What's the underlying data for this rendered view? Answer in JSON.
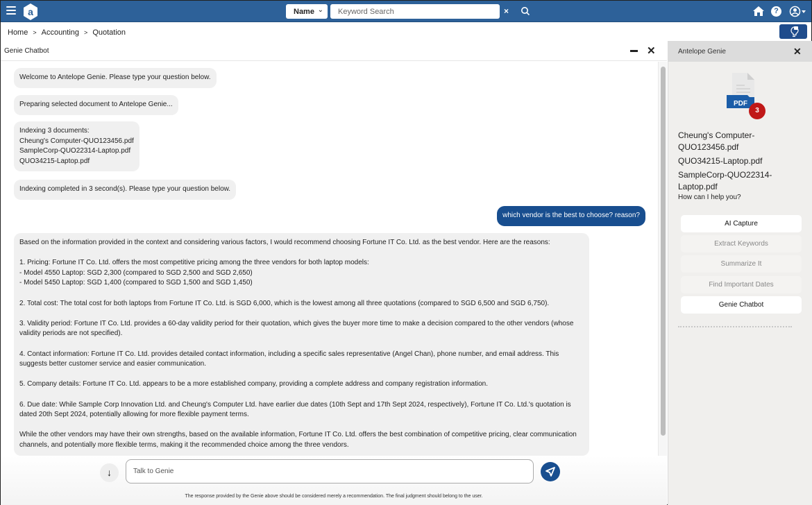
{
  "topbar": {
    "logo_letter": "a",
    "search_type": "Name",
    "search_placeholder": "Keyword Search",
    "search_value": "",
    "clear_label": "×",
    "help_label": "?"
  },
  "breadcrumb": [
    "Home",
    "Accounting",
    "Quotation"
  ],
  "chat": {
    "title": "Genie Chatbot",
    "messages": [
      {
        "role": "bot",
        "text": "Welcome to Antelope Genie. Please type your question below."
      },
      {
        "role": "bot",
        "text": "Preparing selected document to Antelope Genie..."
      },
      {
        "role": "bot",
        "text": "Indexing 3 documents:\nCheung's Computer-QUO123456.pdf\nSampleCorp-QUO22314-Laptop.pdf\nQUO34215-Laptop.pdf"
      },
      {
        "role": "bot",
        "text": "Indexing completed in 3 second(s). Please type your question below."
      },
      {
        "role": "user",
        "text": "which vendor is the best to choose? reason?"
      },
      {
        "role": "bot",
        "text": "Based on the information provided in the context and considering various factors, I would recommend choosing Fortune IT Co. Ltd. as the best vendor. Here are the reasons:\n\n1. Pricing: Fortune IT Co. Ltd. offers the most competitive pricing among the three vendors for both laptop models:\n- Model 4550 Laptop: SGD 2,300 (compared to SGD 2,500 and SGD 2,650)\n- Model 5450 Laptop: SGD 1,400 (compared to SGD 1,500 and SGD 1,450)\n\n2. Total cost: The total cost for both laptops from Fortune IT Co. Ltd. is SGD 6,000, which is the lowest among all three quotations (compared to SGD 6,500 and SGD 6,750).\n\n3. Validity period: Fortune IT Co. Ltd. provides a 60-day validity period for their quotation, which gives the buyer more time to make a decision compared to the other vendors (whose validity periods are not specified).\n\n4. Contact information: Fortune IT Co. Ltd. provides detailed contact information, including a specific sales representative (Angel Chan), phone number, and email address. This suggests better customer service and easier communication.\n\n5. Company details: Fortune IT Co. Ltd. appears to be a more established company, providing a complete address and company registration information.\n\n6. Due date: While Sample Corp Innovation Ltd. and Cheung's Computer Ltd. have earlier due dates (10th Sept and 17th Sept 2024, respectively), Fortune IT Co. Ltd.'s quotation is dated 20th Sept 2024, potentially allowing for more flexible payment terms.\n\nWhile the other vendors may have their own strengths, based on the available information, Fortune IT Co. Ltd. offers the best combination of competitive pricing, clear communication channels, and potentially more flexible terms, making it the recommended choice among the three vendors."
      }
    ],
    "input_placeholder": "Talk to Genie",
    "input_value": "",
    "disclaimer": "The response provided by the Genie above should be considered merely a recommendation. The final judgment should belong to the user."
  },
  "side_panel": {
    "title": "Antelope Genie",
    "pdf_label": "PDF",
    "document_count": "3",
    "files": [
      "Cheung's Computer-QUO123456.pdf",
      "QUO34215-Laptop.pdf",
      "SampleCorp-QUO22314-Laptop.pdf"
    ],
    "help_text": "How can I help you?",
    "actions": [
      {
        "label": "AI Capture",
        "enabled": true
      },
      {
        "label": "Extract Keywords",
        "enabled": false
      },
      {
        "label": "Summarize It",
        "enabled": false
      },
      {
        "label": "Find Important Dates",
        "enabled": false
      },
      {
        "label": "Genie Chatbot",
        "enabled": true
      }
    ]
  },
  "colors": {
    "topbar": "#2d6199",
    "user_bubble": "#184e8f",
    "badge": "#c01818"
  }
}
